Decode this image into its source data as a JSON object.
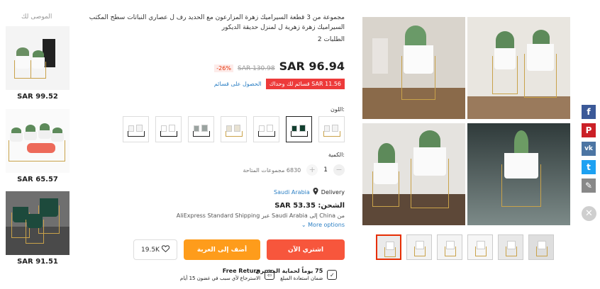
{
  "reco": {
    "title": "الموصى لك",
    "items": [
      {
        "price": "SAR 99.52"
      },
      {
        "price": "SAR 65.57"
      },
      {
        "price": "SAR 91.51"
      }
    ]
  },
  "product": {
    "title": "مجموعة من 3 قطعة السيراميك زهرة المزارعون مع الحديد رف ل عصاري النباتات سطح المكتب السيراميك زهرة زهرية ل لمنزل حديقة الديكور",
    "reviews": "2 الطلبات",
    "price": "SAR 96.94",
    "old_price": "SAR 130.98",
    "discount": "-26%",
    "coupon_badge": "SAR 11.56 قسائم لك وحداك",
    "coupon_link": "الحصول على قسائم",
    "color_label": "اللون:",
    "swatch_count": 7,
    "selected_swatch": 2,
    "qty_label": "الكمية:",
    "qty_value": "1",
    "qty_minus": "−",
    "qty_plus": "+",
    "qty_available": "6830 مجموعات المتاحة",
    "delivery_label": "Delivery",
    "delivery_country": "Saudi Arabia",
    "shipping_price": "الشحن: SAR 53.35",
    "shipping_detail": "من China إلى Saudi Arabia عبر AliExpress Standard Shipping",
    "more_options": "More options",
    "buy_now": "اشتري الآن",
    "add_to_cart": "أضف إلى العربة",
    "wishlist_count": "19.5K",
    "guarantee_title": "75 يوماً لحماية المشتري",
    "guarantee_sub": "ضمان استعادة المبلغ",
    "return_title": "Free Return",
    "return_sub": "الاسترجاع لأي سبب في غضون 15 أيام"
  },
  "social": [
    {
      "icon": "facebook-icon",
      "glyph": "f",
      "color": "#3b5998"
    },
    {
      "icon": "pinterest-icon",
      "glyph": "P",
      "color": "#cb2027"
    },
    {
      "icon": "vk-icon",
      "glyph": "vk",
      "color": "#4c75a3"
    },
    {
      "icon": "twitter-icon",
      "glyph": "t",
      "color": "#1da1f2"
    },
    {
      "icon": "edit-icon",
      "glyph": "✎",
      "color": "#888888"
    }
  ],
  "close_glyph": "✕",
  "thumb_count": 6,
  "selected_thumb": 0,
  "colors": {
    "accent": "#e62e04",
    "cart": "#fe9c1b",
    "buy": "#f7563c",
    "link": "#2b7fc4"
  }
}
